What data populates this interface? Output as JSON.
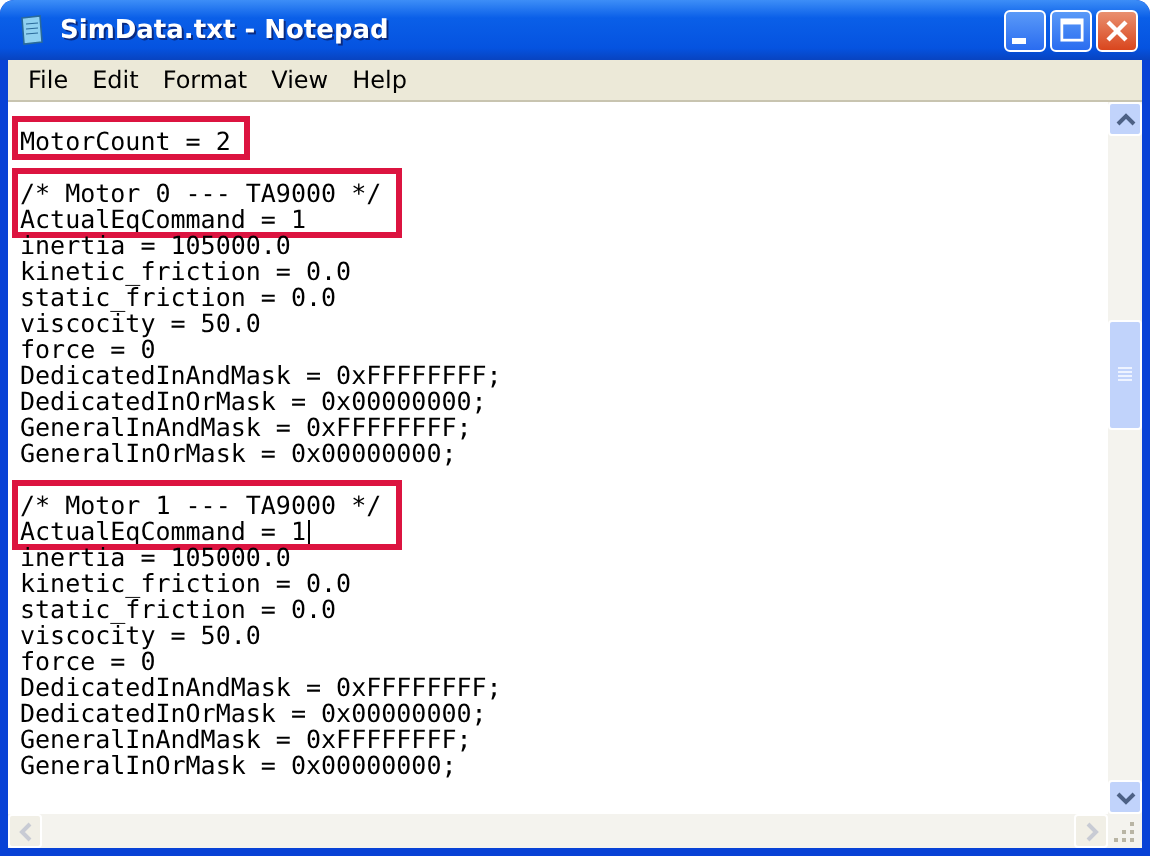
{
  "window": {
    "title": "SimData.txt - Notepad"
  },
  "menu": [
    "File",
    "Edit",
    "Format",
    "View",
    "Help"
  ],
  "editor": {
    "paragraphs": [
      {
        "segments": [
          {
            "highlighted": true,
            "lines": [
              {
                "text": "MotorCount = 2"
              }
            ]
          }
        ]
      },
      {
        "segments": [
          {
            "highlighted": true,
            "lines": [
              {
                "text": "/* Motor 0 --- TA9000 */"
              },
              {
                "text": "ActualEqCommand = 1"
              }
            ]
          },
          {
            "highlighted": false,
            "lines": [
              {
                "text": "inertia = 105000.0"
              },
              {
                "text": "kinetic_friction = 0.0"
              },
              {
                "text": "static_friction = 0.0"
              },
              {
                "text": "viscocity = 50.0"
              },
              {
                "text": "force = 0"
              },
              {
                "text": "DedicatedInAndMask = 0xFFFFFFFF;"
              },
              {
                "text": "DedicatedInOrMask = 0x00000000;"
              },
              {
                "text": "GeneralInAndMask = 0xFFFFFFFF;"
              },
              {
                "text": "GeneralInOrMask = 0x00000000;"
              }
            ]
          }
        ]
      },
      {
        "segments": [
          {
            "highlighted": true,
            "lines": [
              {
                "text": "/* Motor 1 --- TA9000 */"
              },
              {
                "text": "ActualEqCommand = 1",
                "caret": true
              }
            ]
          },
          {
            "highlighted": false,
            "lines": [
              {
                "text": "inertia = 105000.0"
              },
              {
                "text": "kinetic_friction = 0.0"
              },
              {
                "text": "static_friction = 0.0"
              },
              {
                "text": "viscocity = 50.0"
              },
              {
                "text": "force = 0"
              },
              {
                "text": "DedicatedInAndMask = 0xFFFFFFFF;"
              },
              {
                "text": "DedicatedInOrMask = 0x00000000;"
              },
              {
                "text": "GeneralInAndMask = 0xFFFFFFFF;"
              },
              {
                "text": "GeneralInOrMask = 0x00000000;"
              }
            ]
          }
        ]
      }
    ]
  }
}
